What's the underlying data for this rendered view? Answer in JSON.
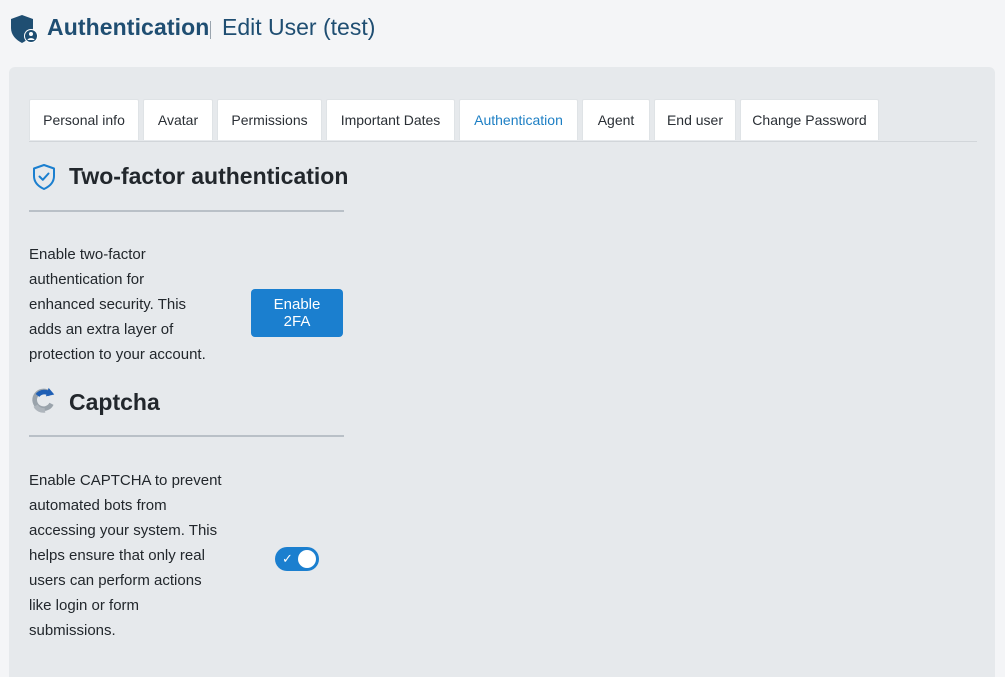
{
  "header": {
    "title": "Authentication",
    "subtitle": "Edit User (test)",
    "icon": "shield-user-icon"
  },
  "tabs": [
    {
      "label": "Personal info",
      "active": false
    },
    {
      "label": "Avatar",
      "active": false
    },
    {
      "label": "Permissions",
      "active": false
    },
    {
      "label": "Important Dates",
      "active": false
    },
    {
      "label": "Authentication",
      "active": true
    },
    {
      "label": "Agent",
      "active": false
    },
    {
      "label": "End user",
      "active": false
    },
    {
      "label": "Change Password",
      "active": false
    }
  ],
  "two_factor": {
    "title": "Two-factor authentication",
    "icon": "shield-check-icon",
    "description": [
      "Enable two-factor",
      "authentication for",
      "enhanced security. This",
      "adds an extra layer of",
      "protection to your account."
    ],
    "button_label_line1": "Enable",
    "button_label_line2": "2FA"
  },
  "captcha": {
    "title": "Captcha",
    "icon": "recaptcha-icon",
    "description": [
      "Enable CAPTCHA to prevent",
      "automated bots from",
      "accessing your system. This",
      "helps ensure that only real",
      "users can perform actions",
      "like login or form",
      "submissions."
    ],
    "toggle_on": true,
    "toggle_check": "✓"
  },
  "colors": {
    "brand": "#1f4e72",
    "accent": "#1b7fcf",
    "panel": "#e6e9ec"
  }
}
